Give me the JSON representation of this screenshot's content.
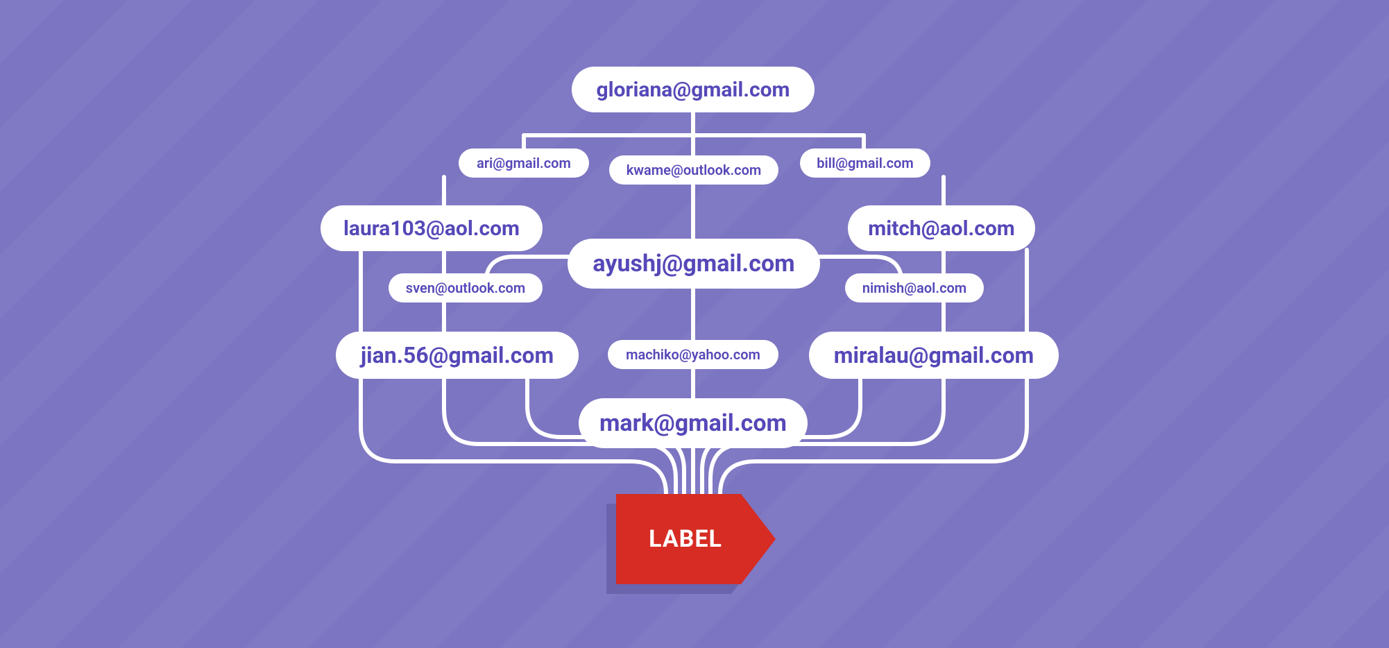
{
  "colors": {
    "pill_bg": "#ffffff",
    "pill_text": "#5548b8",
    "background_light": "#8079c4",
    "background_dark": "#7c75c1",
    "connector": "#ffffff",
    "label_fill": "#d62c23",
    "label_shadow": "#6b64ad",
    "label_text": "#ffffff"
  },
  "label": {
    "text": "LABEL"
  },
  "emails": {
    "gloriana": "gloriana@gmail.com",
    "ari": "ari@gmail.com",
    "kwame": "kwame@outlook.com",
    "bill": "bill@gmail.com",
    "laura103": "laura103@aol.com",
    "mitch": "mitch@aol.com",
    "sven": "sven@outlook.com",
    "ayushj": "ayushj@gmail.com",
    "nimish": "nimish@aol.com",
    "jian56": "jian.56@gmail.com",
    "machiko": "machiko@yahoo.com",
    "miralau": "miralau@gmail.com",
    "mark": "mark@gmail.com"
  }
}
